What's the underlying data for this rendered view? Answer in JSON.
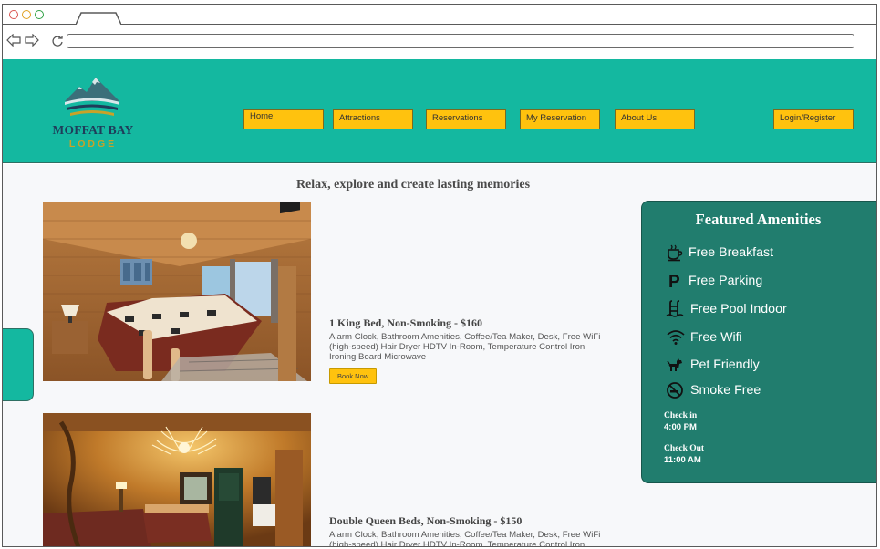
{
  "header": {
    "logo_name": "MOFFAT BAY",
    "logo_sub": "LODGE",
    "nav": [
      "Home",
      "Attractions",
      "Reservations",
      "My Reservation",
      "About Us"
    ],
    "login": "Login/Register",
    "colors": {
      "header_bg": "#14b8a0",
      "button": "#ffc20e"
    }
  },
  "main": {
    "tagline": "Relax, explore and create lasting memories",
    "rooms": [
      {
        "title": "1 King Bed, Non-Smoking - $160",
        "description": "Alarm Clock, Bathroom Amenities, Coffee/Tea Maker, Desk, Free WiFi (high-speed) Hair Dryer HDTV In-Room, Temperature Control Iron Ironing Board Microwave",
        "book_label": "Book Now"
      },
      {
        "title": "Double Queen Beds, Non-Smoking - $150",
        "description": "Alarm Clock, Bathroom Amenities, Coffee/Tea Maker, Desk, Free WiFi (high-speed) Hair Dryer HDTV In-Room, Temperature Control Iron Ironing Board Microwave"
      }
    ]
  },
  "amenities": {
    "title": "Featured Amenities",
    "items": [
      {
        "label": "Free Breakfast",
        "icon": "coffee-icon"
      },
      {
        "label": "Free Parking",
        "icon": "parking-icon"
      },
      {
        "label": "Free Pool Indoor",
        "icon": "pool-icon"
      },
      {
        "label": "Free Wifi",
        "icon": "wifi-icon"
      },
      {
        "label": "Pet Friendly",
        "icon": "pet-icon"
      },
      {
        "label": "Smoke Free",
        "icon": "no-smoking-icon"
      }
    ],
    "checkin_label": "Check in",
    "checkin_time": "4:00 PM",
    "checkout_label": "Check Out",
    "checkout_time": "11:00 AM"
  }
}
